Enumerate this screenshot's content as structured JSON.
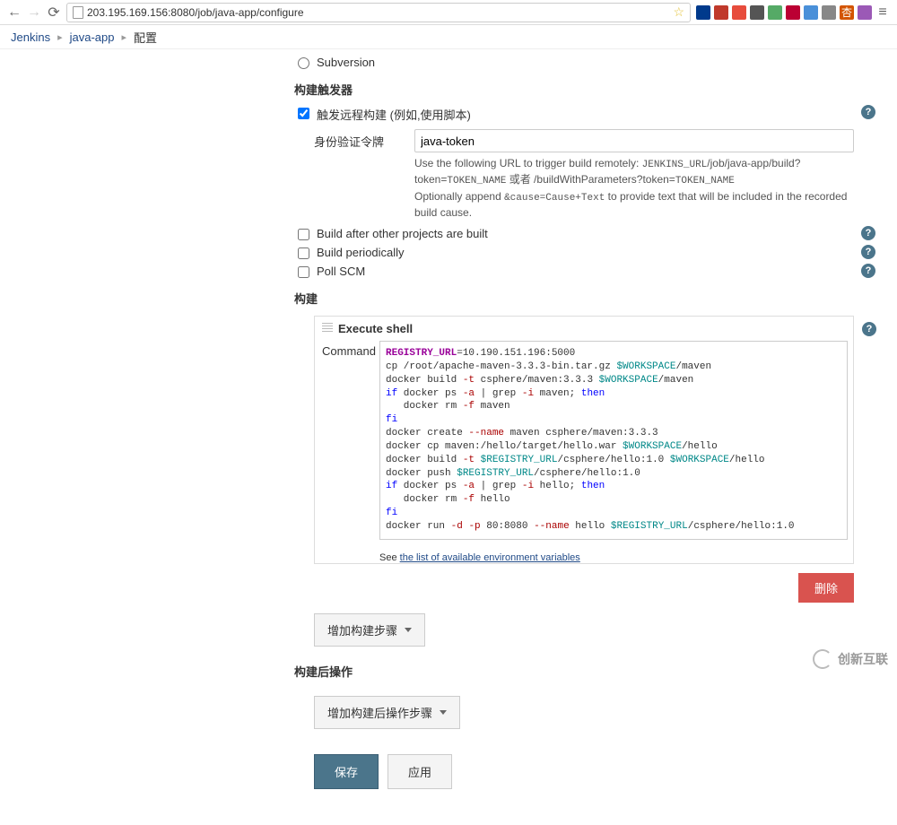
{
  "browser": {
    "url": "203.195.169.156:8080/job/java-app/configure"
  },
  "breadcrumb": {
    "root": "Jenkins",
    "job": "java-app",
    "page": "配置"
  },
  "scm": {
    "subversion": "Subversion"
  },
  "triggers": {
    "title": "构建触发器",
    "remote_label": "触发远程构建 (例如,使用脚本)",
    "token_label": "身份验证令牌",
    "token_value": "java-token",
    "help_line1_pre": "Use the following URL to trigger build remotely: ",
    "help_line1_mono": "JENKINS_URL",
    "help_line1_post": "/job/java-app/build?token=",
    "help_line1_mono2": "TOKEN_NAME",
    "help_line1_or": " 或者 /buildWithParameters?token=",
    "help_line1_mono3": "TOKEN_NAME",
    "help_line2_pre": "Optionally append ",
    "help_line2_mono": "&cause=Cause+Text",
    "help_line2_post": " to provide text that will be included in the recorded build cause.",
    "build_after": "Build after other projects are built",
    "periodically": "Build periodically",
    "poll_scm": "Poll SCM"
  },
  "build": {
    "title": "构建",
    "execute_shell": "Execute shell",
    "command_label": "Command",
    "env_link_pre": "See ",
    "env_link": "the list of available environment variables",
    "delete": "删除",
    "add_step": "增加构建步骤"
  },
  "post_build": {
    "title": "构建后操作",
    "add_step": "增加构建后操作步骤"
  },
  "buttons": {
    "save": "保存",
    "apply": "应用"
  },
  "shell": {
    "l1_var": "REGISTRY_URL",
    "l1_rest": "=10.190.151.196:5000",
    "l2_a": "cp /root/apache-maven-3.3.3-bin.tar.gz ",
    "l2_var": "$WORKSPACE",
    "l2_b": "/maven",
    "l3_a": "docker build ",
    "l3_flag": "-t",
    "l3_b": " csphere/maven:3.3.3 ",
    "l3_var": "$WORKSPACE",
    "l3_c": "/maven",
    "l4_if": "if",
    "l4_a": " docker ps ",
    "l4_flag": "-a",
    "l4_b": " | grep ",
    "l4_flag2": "-i",
    "l4_c": " maven; ",
    "l4_then": "then",
    "l5_a": "   docker rm ",
    "l5_flag": "-f",
    "l5_b": " maven",
    "l6": "fi",
    "l7_a": "docker create ",
    "l7_flag": "--name",
    "l7_b": " maven csphere/maven:3.3.3",
    "l8_a": "docker cp maven:/hello/target/hello.war ",
    "l8_var": "$WORKSPACE",
    "l8_b": "/hello",
    "l9_a": "docker build ",
    "l9_flag": "-t",
    "l9_b": " ",
    "l9_var": "$REGISTRY_URL",
    "l9_c": "/csphere/hello:1.0 ",
    "l9_var2": "$WORKSPACE",
    "l9_d": "/hello",
    "l10_a": "docker push ",
    "l10_var": "$REGISTRY_URL",
    "l10_b": "/csphere/hello:1.0",
    "l11_if": "if",
    "l11_a": " docker ps ",
    "l11_flag": "-a",
    "l11_b": " | grep ",
    "l11_flag2": "-i",
    "l11_c": " hello; ",
    "l11_then": "then",
    "l12_a": "   docker rm ",
    "l12_flag": "-f",
    "l12_b": " hello",
    "l13": "fi",
    "l14_a": "docker run ",
    "l14_flag1": "-d",
    "l14_b": " ",
    "l14_flag2": "-p",
    "l14_c": " 80:8080 ",
    "l14_flag3": "--name",
    "l14_d": " hello ",
    "l14_var": "$REGISTRY_URL",
    "l14_e": "/csphere/hello:1.0"
  },
  "watermark": {
    "text": "创新互联"
  }
}
